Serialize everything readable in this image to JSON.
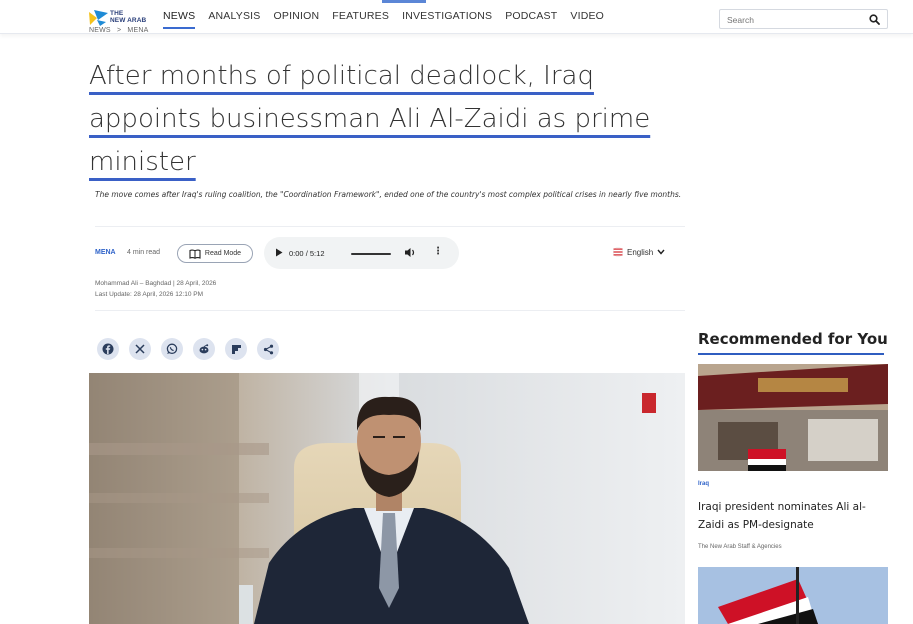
{
  "site": {
    "logo_text": "THE NEW ARAB",
    "logo_line1": "THE",
    "logo_line2": "NEW ARAB"
  },
  "nav": {
    "items": [
      {
        "label": "NEWS",
        "active": true
      },
      {
        "label": "ANALYSIS",
        "active": false
      },
      {
        "label": "OPINION",
        "active": false
      },
      {
        "label": "FEATURES",
        "active": false
      },
      {
        "label": "INVESTIGATIONS",
        "active": false
      },
      {
        "label": "PODCAST",
        "active": false
      },
      {
        "label": "VIDEO",
        "active": false
      }
    ],
    "search_placeholder": "Search"
  },
  "breadcrumb": [
    "NEWS",
    ">",
    "MENA"
  ],
  "article": {
    "headline_line1": "After months of political deadlock, Iraq",
    "headline_line2": "appoints businessman Ali Al-Zaidi as prime",
    "headline_line3": "minister",
    "standfirst": "The move comes after Iraq's ruling coalition, the \"Coordination Framework\", ended one of the country's most complex political crises in nearly five months.",
    "category": "MENA",
    "read_time": "4 min read",
    "read_mode_label": "Read Mode",
    "audio": {
      "current": "0:00",
      "separator": "/",
      "duration": "5:12"
    },
    "language": "English",
    "byline": "Mohammad Ali – Baghdad | 28 April, 2026",
    "last_update": "Last Update: 28 April, 2026 12:10 PM"
  },
  "share": [
    "facebook-icon",
    "x-icon",
    "whatsapp-icon",
    "reddit-icon",
    "flipboard-icon",
    "share-icon"
  ],
  "sidebar": {
    "title": "Recommended for You",
    "items": [
      {
        "tag": "Iraq",
        "headline": "Iraqi president nominates Ali al-Zaidi as PM-designate",
        "source": "The New Arab Staff & Agencies"
      }
    ]
  },
  "colors": {
    "accent": "#3a60c6",
    "tag": "#2f63c9",
    "share_bg": "#dde3ef",
    "share_icon": "#2b3d5c"
  }
}
